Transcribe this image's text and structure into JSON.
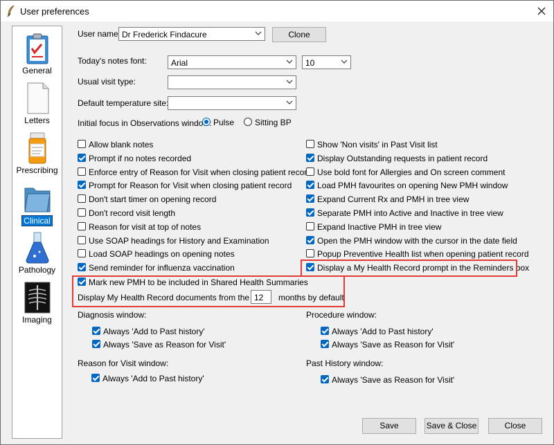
{
  "window": {
    "title": "User preferences"
  },
  "sidebar": {
    "items": [
      {
        "label": "General",
        "icon": "clipboard-icon"
      },
      {
        "label": "Letters",
        "icon": "document-icon"
      },
      {
        "label": "Prescribing",
        "icon": "pill-bottle-icon"
      },
      {
        "label": "Clinical",
        "icon": "folder-icon",
        "active": true
      },
      {
        "label": "Pathology",
        "icon": "flask-icon"
      },
      {
        "label": "Imaging",
        "icon": "xray-icon"
      }
    ]
  },
  "form": {
    "user_name_label": "User name:",
    "user_name_value": "Dr Frederick Findacure",
    "clone_label": "Clone",
    "notes_font_label": "Today's notes font:",
    "notes_font_value": "Arial",
    "notes_font_size": "10",
    "visit_type_label": "Usual visit type:",
    "visit_type_value": "",
    "temp_site_label": "Default temperature site:",
    "temp_site_value": "",
    "focus_label": "Initial focus in Observations window:",
    "focus_options": [
      {
        "label": "Pulse",
        "checked": true
      },
      {
        "label": "Sitting BP",
        "checked": false
      }
    ]
  },
  "left_options": [
    {
      "label": "Allow blank notes",
      "checked": false
    },
    {
      "label": "Prompt if no notes recorded",
      "checked": true
    },
    {
      "label": "Enforce entry of Reason for Visit when closing patient record",
      "checked": false
    },
    {
      "label": "Prompt for Reason for Visit when closing patient record",
      "checked": true
    },
    {
      "label": "Don't start timer on opening record",
      "checked": false
    },
    {
      "label": "Don't record visit length",
      "checked": false
    },
    {
      "label": "Reason for visit at top of notes",
      "checked": false
    },
    {
      "label": "Use SOAP headings for History and Examination",
      "checked": false
    },
    {
      "label": "Load SOAP headings on opening notes",
      "checked": false
    },
    {
      "label": "Send reminder for influenza vaccination",
      "checked": true
    }
  ],
  "right_options": [
    {
      "label": "Show 'Non visits' in Past Visit list",
      "checked": false
    },
    {
      "label": "Display Outstanding requests in patient record",
      "checked": true
    },
    {
      "label": "Use bold font for Allergies and On screen comment",
      "checked": false
    },
    {
      "label": "Load PMH favourites on opening New PMH window",
      "checked": true
    },
    {
      "label": "Expand Current Rx and PMH in tree view",
      "checked": true
    },
    {
      "label": "Separate PMH into Active and Inactive in tree view",
      "checked": true
    },
    {
      "label": "Expand Inactive PMH in tree view",
      "checked": false
    },
    {
      "label": "Open the PMH window with the cursor in the date field",
      "checked": true
    },
    {
      "label": "Popup Preventive Health list when opening patient record",
      "checked": false
    },
    {
      "label": "Display a My Health Record prompt in the Reminders box",
      "checked": true
    }
  ],
  "shared": {
    "mark_pmh_label": "Mark new PMH to be included in Shared Health Summaries",
    "mark_pmh_checked": true,
    "mhr_docs_label": "Display My Health Record documents from the last:",
    "mhr_docs_value": "12",
    "mhr_docs_suffix": "months by default"
  },
  "sections": {
    "diagnosis": {
      "title": "Diagnosis window:",
      "items": [
        {
          "label": "Always 'Add to Past history'",
          "checked": true
        },
        {
          "label": "Always 'Save as Reason for Visit'",
          "checked": true
        }
      ]
    },
    "procedure": {
      "title": "Procedure window:",
      "items": [
        {
          "label": "Always 'Add to Past history'",
          "checked": true
        },
        {
          "label": "Always 'Save as Reason for Visit'",
          "checked": true
        }
      ]
    },
    "reason": {
      "title": "Reason for Visit window:",
      "items": [
        {
          "label": "Always 'Add to Past history'",
          "checked": true
        }
      ]
    },
    "past": {
      "title": "Past History window:",
      "items": [
        {
          "label": "Always 'Save as Reason for Visit'",
          "checked": true
        }
      ]
    }
  },
  "footer": {
    "save": "Save",
    "save_close": "Save & Close",
    "close": "Close"
  },
  "colors": {
    "accent": "#0067c0",
    "highlight": "#e53935",
    "selection": "#0078d7"
  }
}
